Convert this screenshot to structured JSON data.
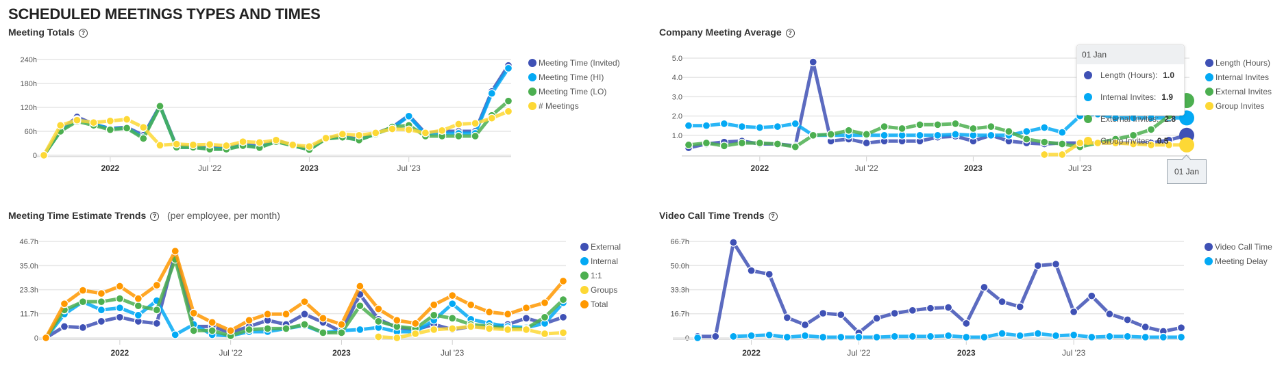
{
  "page": {
    "title": "SCHEDULED MEETINGS TYPES AND TIMES"
  },
  "panels": {
    "meeting_totals": {
      "title": "Meeting Totals",
      "help_icon": "help-circle-icon"
    },
    "company_average": {
      "title": "Company Meeting Average",
      "help_icon": "help-circle-icon"
    },
    "time_estimate": {
      "title": "Meeting Time Estimate Trends",
      "subtitle": "(per employee, per month)",
      "help_icon": "help-circle-icon"
    },
    "video_call": {
      "title": "Video Call Time Trends",
      "help_icon": "help-circle-icon"
    }
  },
  "tooltip": {
    "header": "01 Jan",
    "rows": [
      {
        "label": "Length (Hours):",
        "value": "1.0",
        "color": "#3f51b5"
      },
      {
        "label": "Internal Invites:",
        "value": "1.9",
        "color": "#03a9f4"
      },
      {
        "label": "External Invites:",
        "value": "2.8",
        "color": "#4caf50"
      },
      {
        "label": "Group Invites:",
        "value": "0.5",
        "color": "#fdd835"
      }
    ],
    "crosshair_label": "01 Jan"
  },
  "chart_data": [
    {
      "id": "meeting_totals",
      "type": "line",
      "title": "Meeting Totals",
      "x_start": "Sep 2021",
      "x_count": 29,
      "x_ticks": [
        {
          "index": 4,
          "label": "2022",
          "bold": true
        },
        {
          "index": 10,
          "label": "Jul '22",
          "bold": false
        },
        {
          "index": 16,
          "label": "2023",
          "bold": true
        },
        {
          "index": 22,
          "label": "Jul '23",
          "bold": false
        }
      ],
      "ylim": [
        0,
        240
      ],
      "y_ticks": [
        {
          "value": 0,
          "label": "0"
        },
        {
          "value": 60,
          "label": "60h"
        },
        {
          "value": 120,
          "label": "120h"
        },
        {
          "value": 180,
          "label": "180h"
        },
        {
          "value": 240,
          "label": "240h"
        }
      ],
      "grid": true,
      "legend": "right",
      "series": [
        {
          "name": "Meeting Time (Invited)",
          "color": "#3f51b5",
          "values": [
            0,
            62,
            96,
            78,
            67,
            70,
            50,
            124,
            22,
            22,
            18,
            18,
            27,
            22,
            37,
            25,
            15,
            43,
            47,
            40,
            55,
            70,
            100,
            55,
            60,
            60,
            60,
            160,
            225
          ]
        },
        {
          "name": "Meeting Time (HI)",
          "color": "#03a9f4",
          "values": [
            0,
            60,
            90,
            78,
            66,
            68,
            45,
            123,
            20,
            20,
            16,
            16,
            25,
            20,
            35,
            24,
            14,
            42,
            46,
            38,
            54,
            68,
            98,
            52,
            55,
            55,
            55,
            155,
            218
          ]
        },
        {
          "name": "Meeting Time (LO)",
          "color": "#4caf50",
          "values": [
            0,
            60,
            85,
            75,
            64,
            68,
            42,
            123,
            20,
            20,
            15,
            15,
            24,
            19,
            34,
            24,
            14,
            41,
            45,
            38,
            53,
            71,
            75,
            48,
            48,
            48,
            48,
            100,
            136
          ]
        },
        {
          "name": "# Meetings",
          "color": "#fdd835",
          "values": [
            0,
            75,
            88,
            82,
            86,
            90,
            70,
            25,
            28,
            26,
            27,
            24,
            34,
            32,
            38,
            26,
            22,
            43,
            53,
            50,
            56,
            66,
            64,
            56,
            62,
            78,
            80,
            93,
            110
          ]
        }
      ]
    },
    {
      "id": "company_average",
      "type": "line",
      "title": "Company Meeting Average",
      "x_start": "Sep 2021",
      "x_count": 29,
      "x_ticks": [
        {
          "index": 4,
          "label": "2022",
          "bold": true
        },
        {
          "index": 10,
          "label": "Jul '22",
          "bold": false
        },
        {
          "index": 16,
          "label": "2023",
          "bold": true
        },
        {
          "index": 22,
          "label": "Jul '23",
          "bold": false
        }
      ],
      "ylim": [
        0,
        5
      ],
      "y_ticks": [
        {
          "value": 1,
          "label": "1.0"
        },
        {
          "value": 2,
          "label": "2.0"
        },
        {
          "value": 3,
          "label": "3.0"
        },
        {
          "value": 4,
          "label": "4.0"
        },
        {
          "value": 5,
          "label": "5.0"
        }
      ],
      "grid": true,
      "legend": "right",
      "series": [
        {
          "name": "Length (Hours)",
          "color": "#3f51b5",
          "values": [
            0.35,
            0.55,
            0.65,
            0.7,
            0.55,
            0.55,
            0.45,
            4.8,
            0.7,
            0.8,
            0.6,
            0.7,
            0.7,
            0.7,
            0.9,
            0.95,
            0.7,
            1.0,
            0.7,
            0.6,
            0.55,
            0.6,
            0.6,
            0.6,
            0.6,
            0.6,
            0.6,
            0.75,
            1.0
          ]
        },
        {
          "name": "Internal Invites",
          "color": "#03a9f4",
          "values": [
            1.5,
            1.5,
            1.6,
            1.45,
            1.4,
            1.45,
            1.6,
            1.0,
            1.0,
            1.0,
            1.0,
            1.0,
            1.0,
            1.0,
            1.0,
            1.05,
            1.0,
            1.0,
            1.0,
            1.2,
            1.4,
            1.15,
            2.0,
            2.1,
            1.9,
            1.9,
            1.9,
            1.9,
            1.9
          ]
        },
        {
          "name": "External Invites",
          "color": "#4caf50",
          "values": [
            0.5,
            0.6,
            0.45,
            0.6,
            0.6,
            0.55,
            0.4,
            1.0,
            1.05,
            1.25,
            1.05,
            1.45,
            1.35,
            1.55,
            1.55,
            1.6,
            1.35,
            1.45,
            1.2,
            0.8,
            0.65,
            0.55,
            0.4,
            0.6,
            0.8,
            1.0,
            1.3,
            2.0,
            2.8
          ]
        },
        {
          "name": "Group Invites",
          "color": "#fdd835",
          "values": [
            null,
            null,
            null,
            null,
            null,
            null,
            null,
            null,
            null,
            null,
            null,
            null,
            null,
            null,
            null,
            null,
            null,
            null,
            null,
            null,
            0.0,
            0.0,
            0.6,
            0.6,
            0.6,
            0.55,
            0.5,
            0.5,
            0.5
          ]
        }
      ]
    },
    {
      "id": "time_estimate",
      "type": "line",
      "title": "Meeting Time Estimate Trends",
      "subtitle": "(per employee, per month)",
      "x_start": "Sep 2021",
      "x_count": 29,
      "x_ticks": [
        {
          "index": 4,
          "label": "2022",
          "bold": true
        },
        {
          "index": 10,
          "label": "Jul '22",
          "bold": false
        },
        {
          "index": 16,
          "label": "2023",
          "bold": true
        },
        {
          "index": 22,
          "label": "Jul '23",
          "bold": false
        }
      ],
      "ylim": [
        0,
        46.7
      ],
      "y_ticks": [
        {
          "value": 0,
          "label": "0"
        },
        {
          "value": 11.7,
          "label": "11.7h"
        },
        {
          "value": 23.3,
          "label": "23.3h"
        },
        {
          "value": 35.0,
          "label": "35.0h"
        },
        {
          "value": 46.7,
          "label": "46.7h"
        }
      ],
      "grid": true,
      "legend": "right",
      "series": [
        {
          "name": "External",
          "color": "#3f51b5",
          "values": [
            0,
            5.5,
            5,
            8,
            10,
            8,
            7,
            41,
            5.5,
            5.5,
            2.5,
            5.5,
            8.5,
            6.5,
            11.5,
            7.5,
            3,
            21,
            9,
            5,
            4,
            6.5,
            4,
            5.5,
            5,
            6.5,
            9.5,
            7,
            10
          ]
        },
        {
          "name": "Internal",
          "color": "#03a9f4",
          "values": [
            0,
            11.5,
            17.5,
            13.5,
            14.5,
            11,
            18,
            1.5,
            6.5,
            1.5,
            1,
            3,
            3,
            4.5,
            6,
            2.5,
            3.5,
            4,
            5,
            3,
            3,
            8.5,
            16.5,
            9,
            7,
            5.5,
            5,
            7,
            17
          ]
        },
        {
          "name": "1:1",
          "color": "#4caf50",
          "values": [
            0,
            13.5,
            17.5,
            17.5,
            19,
            15.5,
            13.5,
            38,
            3.5,
            3.5,
            1,
            4,
            4.5,
            4.5,
            6.5,
            2.5,
            2.5,
            15.5,
            8,
            5.5,
            4.5,
            11,
            9.5,
            6.5,
            5.5,
            4.5,
            4.5,
            10,
            18.5
          ]
        },
        {
          "name": "Groups",
          "color": "#fdd835",
          "values": [
            null,
            null,
            null,
            null,
            null,
            null,
            null,
            null,
            null,
            null,
            null,
            null,
            null,
            null,
            null,
            null,
            null,
            null,
            0.5,
            0,
            2,
            4,
            4.5,
            5.5,
            4.5,
            4,
            4,
            2,
            2.5
          ]
        },
        {
          "name": "Total",
          "color": "#ff9800",
          "values": [
            0,
            16.5,
            23,
            21.5,
            25,
            19,
            25.5,
            42,
            12,
            7.5,
            3.5,
            8.5,
            11.5,
            11.5,
            17.5,
            9.5,
            6.5,
            25,
            14,
            8.5,
            7,
            16,
            20.5,
            16,
            12.5,
            11.5,
            14.5,
            17,
            27.5
          ]
        }
      ]
    },
    {
      "id": "video_call",
      "type": "line",
      "title": "Video Call Time Trends",
      "x_start": "Sep 2021",
      "x_count": 29,
      "x_ticks": [
        {
          "index": 4,
          "label": "2022",
          "bold": true
        },
        {
          "index": 10,
          "label": "Jul '22",
          "bold": false
        },
        {
          "index": 16,
          "label": "2023",
          "bold": true
        },
        {
          "index": 22,
          "label": "Jul '23",
          "bold": false
        }
      ],
      "ylim": [
        0,
        66.7
      ],
      "y_ticks": [
        {
          "value": 0,
          "label": "0"
        },
        {
          "value": 16.7,
          "label": "16.7h"
        },
        {
          "value": 33.3,
          "label": "33.3h"
        },
        {
          "value": 50.0,
          "label": "50.0h"
        },
        {
          "value": 66.7,
          "label": "66.7h"
        }
      ],
      "grid": true,
      "legend": "right",
      "series": [
        {
          "name": "Video Call Time",
          "color": "#3f51b5",
          "values": [
            null,
            1,
            1,
            66,
            46.5,
            44,
            14,
            9,
            17,
            16,
            3.5,
            13.5,
            17,
            19,
            20.5,
            21,
            10,
            35,
            25,
            21.5,
            50,
            51,
            18,
            29,
            16.5,
            12.5,
            7.5,
            4.5,
            7
          ]
        },
        {
          "name": "Meeting Delay",
          "color": "#03a9f4",
          "values": [
            null,
            0,
            null,
            1,
            1.5,
            2,
            0.5,
            1.5,
            0.5,
            0.5,
            0.5,
            0.5,
            1,
            1,
            1,
            1.5,
            0.5,
            0.5,
            3,
            1.5,
            3,
            1.5,
            2,
            0.5,
            1,
            1,
            0.5,
            0.5,
            0.5
          ]
        }
      ]
    }
  ]
}
